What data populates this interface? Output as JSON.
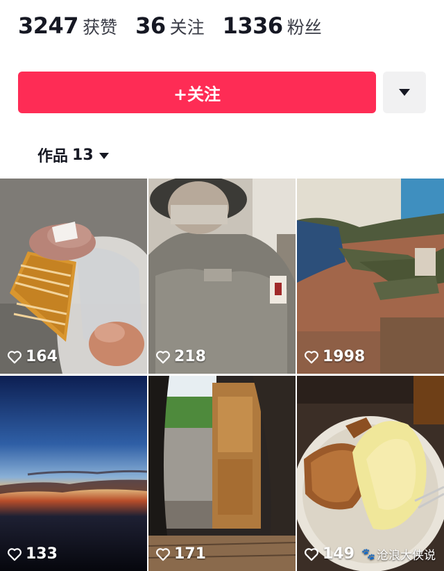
{
  "stats": [
    {
      "value": "3247",
      "label": "获赞"
    },
    {
      "value": "36",
      "label": "关注"
    },
    {
      "value": "1336",
      "label": "粉丝"
    }
  ],
  "follow_button": {
    "label": "+关注"
  },
  "more_button": {
    "icon": "caret-down-icon"
  },
  "works_tab": {
    "label": "作品",
    "count": "13"
  },
  "videos": [
    {
      "likes": "164",
      "subject": "cake slice in hand"
    },
    {
      "likes": "218",
      "subject": "soldier selfie"
    },
    {
      "likes": "1998",
      "subject": "soldiers resting on floor"
    },
    {
      "likes": "133",
      "subject": "dusk sky over horizon"
    },
    {
      "likes": "171",
      "subject": "view out of tent door"
    },
    {
      "likes": "149",
      "subject": "roast chicken and mashed potatoes"
    }
  ],
  "watermark": "沧浪大侠说",
  "colors": {
    "accent": "#fe2c55",
    "text": "#161823",
    "secondary_bg": "#f1f1f2"
  }
}
